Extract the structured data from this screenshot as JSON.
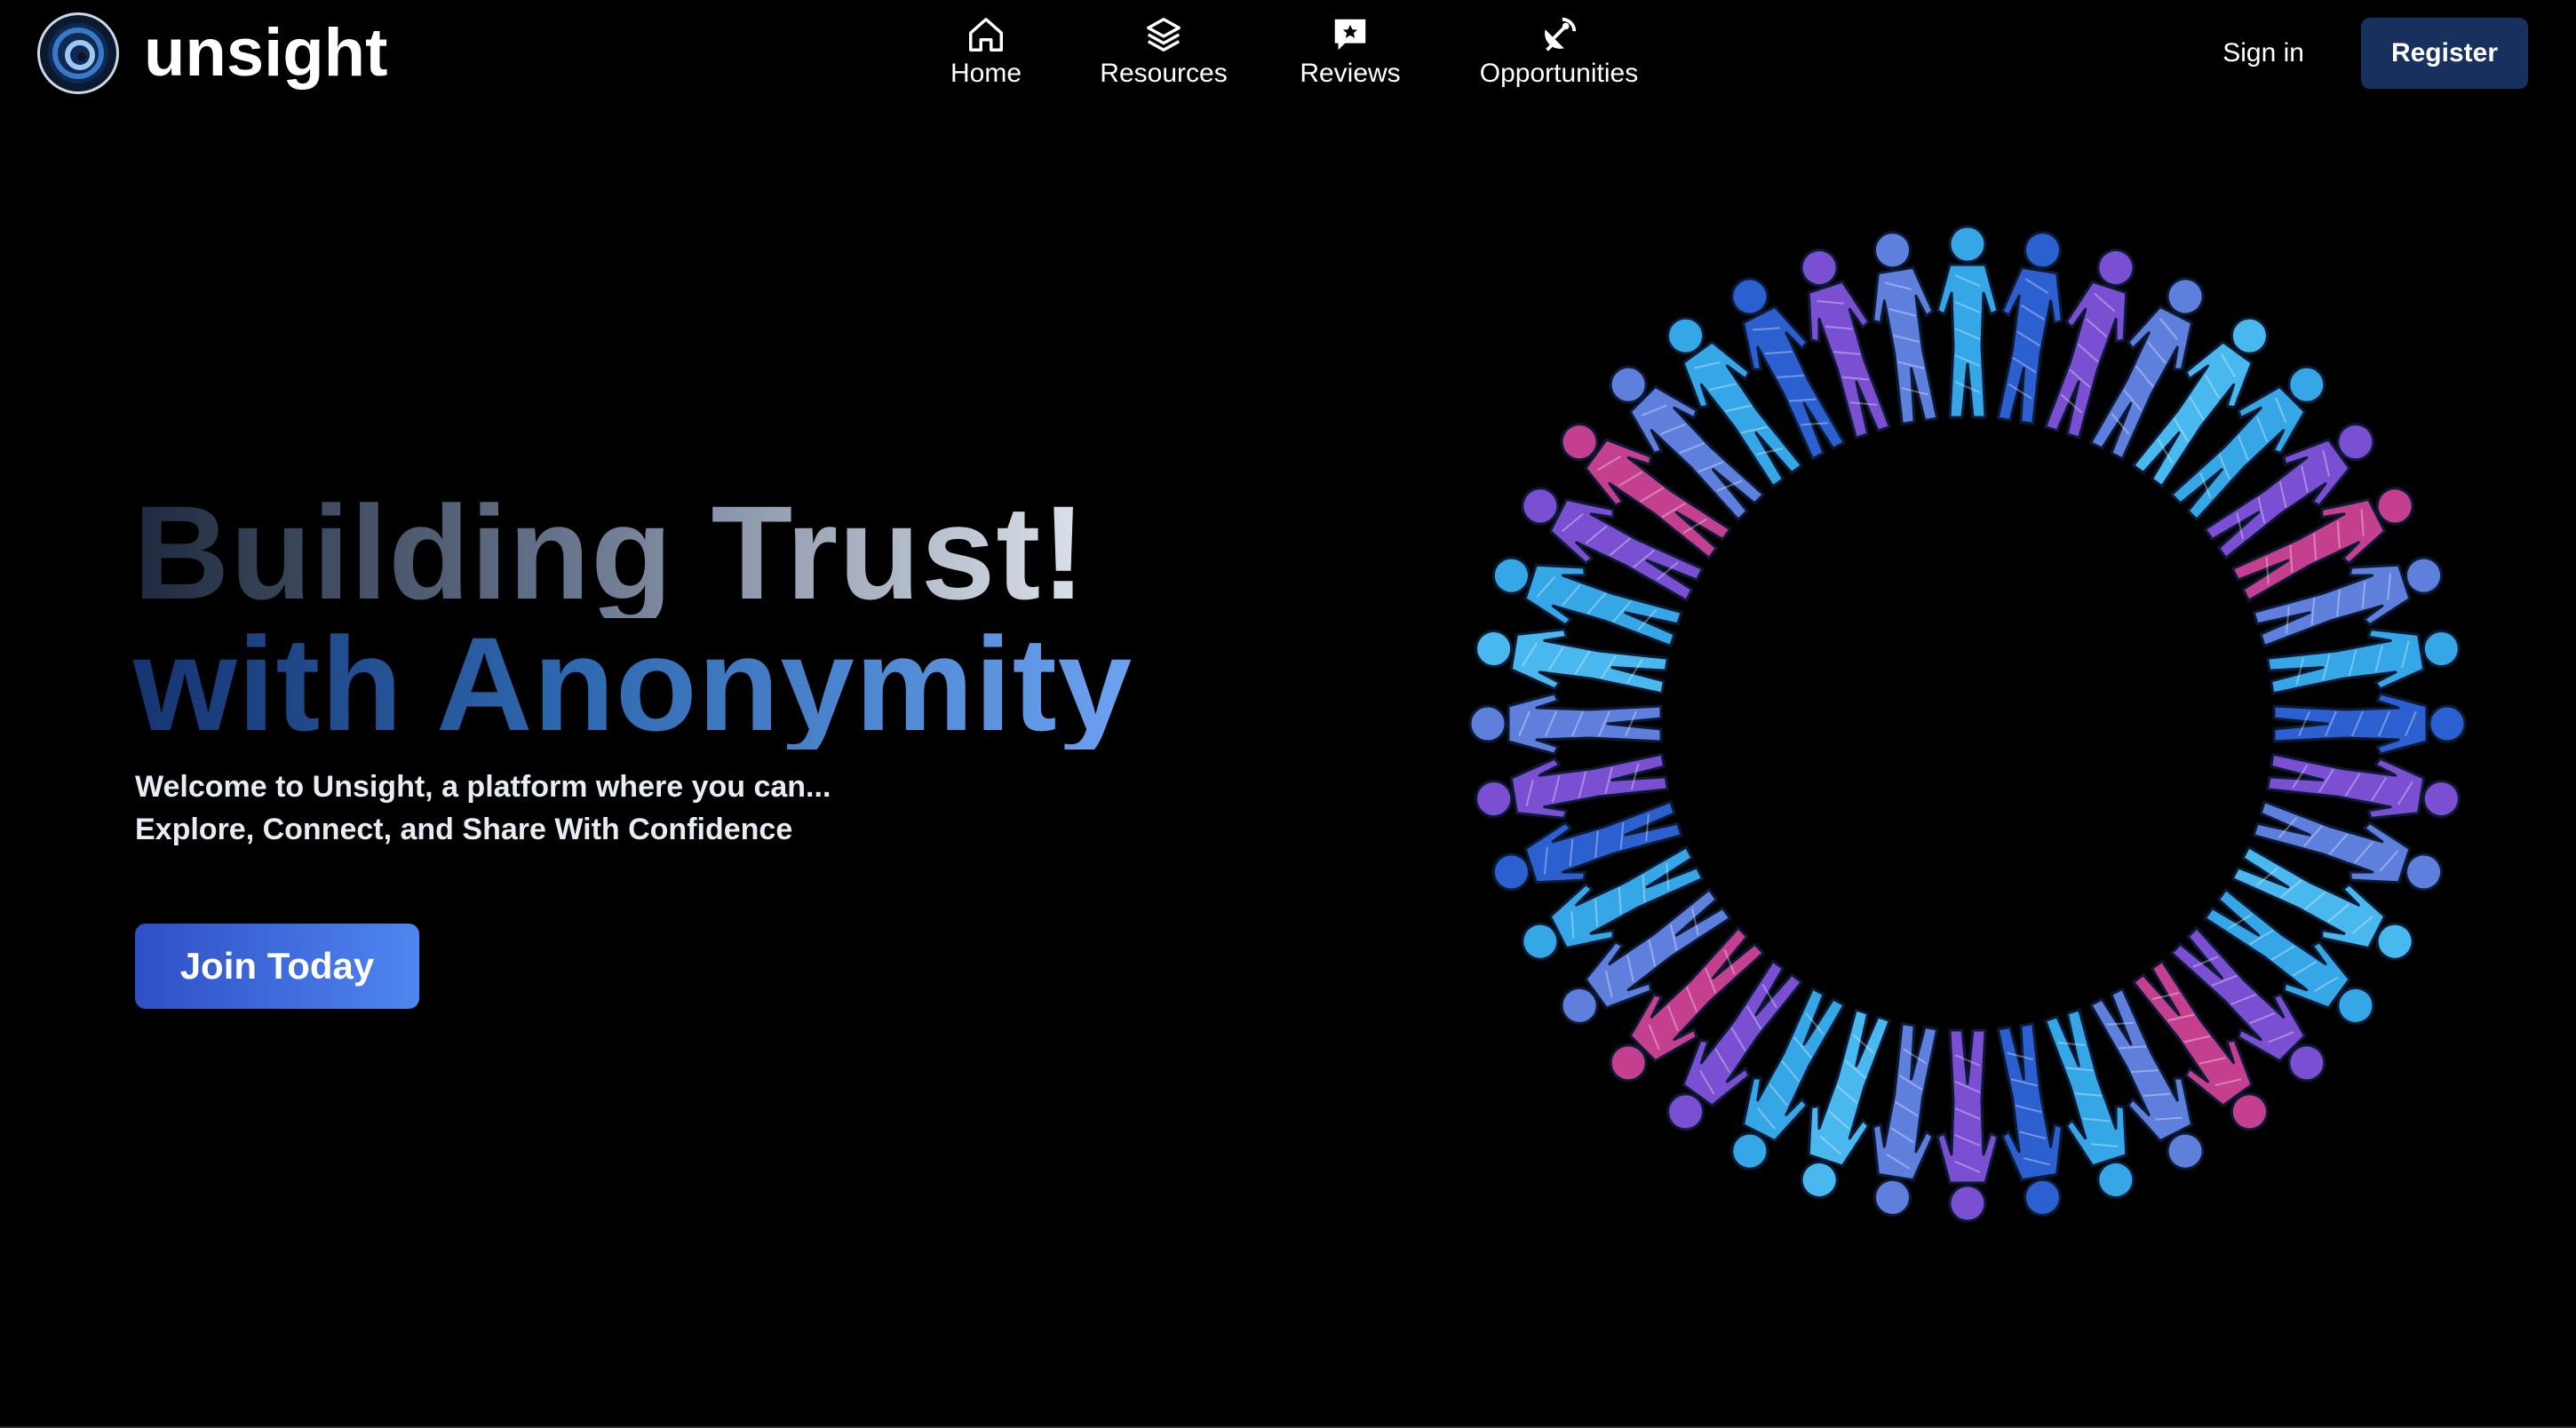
{
  "brand": {
    "name": "unsight",
    "logo_icon": "eye-logo-icon"
  },
  "nav": {
    "items": [
      {
        "label": "Home",
        "icon": "home-icon"
      },
      {
        "label": "Resources",
        "icon": "layers-icon"
      },
      {
        "label": "Reviews",
        "icon": "star-message-icon"
      },
      {
        "label": "Opportunities",
        "icon": "satellite-dish-icon"
      }
    ]
  },
  "auth": {
    "signin_label": "Sign in",
    "register_label": "Register"
  },
  "hero": {
    "headline_line1": "Building Trust!",
    "headline_line2": "with Anonymity",
    "subtitle_line1": "Welcome to Unsight, a platform where you can...",
    "subtitle_line2": "Explore, Connect, and Share With Confidence",
    "cta_label": "Join Today",
    "illustration": "people-circle-illustration"
  },
  "colors": {
    "background": "#000000",
    "register_button": "#17305e",
    "cta_gradient_start": "#2f4fc6",
    "cta_gradient_end": "#4f86f0",
    "figure_palette": [
      "#35a7e6",
      "#2c5fd0",
      "#7a4fd1",
      "#c4408f",
      "#5f7fdc",
      "#48b8ee"
    ]
  }
}
